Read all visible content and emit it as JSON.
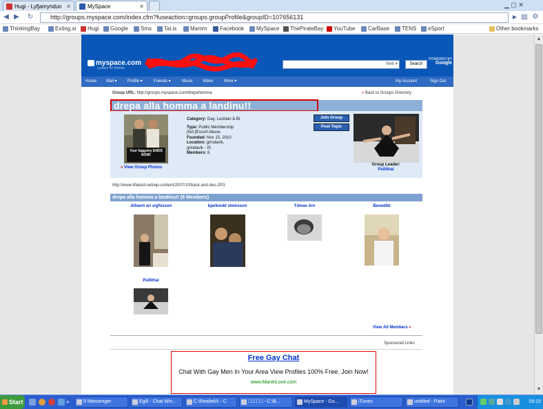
{
  "browser": {
    "tabs": [
      {
        "label": "Hugi - Lyfjamyndun",
        "active": false
      },
      {
        "label": "MySpace",
        "active": true
      }
    ],
    "url": "http://groups.myspace.com/index.cfm?fuseaction=groups.groupProfile&groupID=107656131",
    "bookmarks": [
      "ThinkingBay",
      "Exting.si",
      "Hugi",
      "Google",
      "Sms",
      "Tal.is",
      "Mamm",
      "Facebook",
      "MySpace",
      "ThePirateBay",
      "YouTube",
      "CarBase",
      "TENS",
      "eSport"
    ],
    "other_bookmarks": "Other bookmarks"
  },
  "myspace": {
    "logo": "myspace.com",
    "tagline": "a place for friends",
    "search_scope": "Web",
    "search_button": "Search",
    "powered_by": "POWERED BY",
    "google": "Google",
    "nav": [
      "Home",
      "Mail ▾",
      "Profile ▾",
      "Friends ▾",
      "Music",
      "Video",
      "More ▾"
    ],
    "nav_right": [
      "My Account",
      "Sign Out"
    ]
  },
  "group": {
    "url_label": "Group URL:",
    "url_value": "http://groups.myspace.com/drepahomma",
    "back_link": "Back to Groups Directory",
    "title": "drepa alla homma a landinu!!",
    "photo_caption": "Your faggotry ENDS NOW!",
    "view_photos": "View Group Photos",
    "details": [
      {
        "label": "Category:",
        "value": "Gay, Lesbian & Bi"
      },
      {
        "label": "Type:",
        "value": "Public Membership"
      },
      {
        "label": "",
        "value": "[hot:]Escort Abuse"
      },
      {
        "label": "Founded:",
        "value": "Nov 15, 2010"
      },
      {
        "label": "Location:",
        "value": "grindavik,"
      },
      {
        "label": "",
        "value": "grindavik - IS"
      },
      {
        "label": "Members:",
        "value": "6"
      }
    ],
    "join_button": "Join Group",
    "post_button": "Post Topic",
    "leader_label": "Group Leader:",
    "leader_name": "Pullithai",
    "image_url": "http://www.lifaetull.net/wp-content/2007/10/back-and-deo.JPG",
    "members_header": "drepa alla homma a landinu!! (6 Members)",
    "members": [
      "Jóhann ari sigfússon",
      "bjarkiodd steinsson",
      "Tómas örn",
      "Benedikt",
      "Pullithai"
    ],
    "view_all": "View All Members",
    "sponsored": "Sponsored Links"
  },
  "ad": {
    "title": "Free Gay Chat",
    "text": "Chat With Gay Men In Your Area View Profiles 100% Free. Join Now!",
    "url": "www.ManInLove.com"
  },
  "taskbar": {
    "start": "Start",
    "buttons": [
      "9 Messenger",
      "Egill - Chat Win...",
      "C:\\Realtek\\I - C",
      "□□□□□ - C:\\B...",
      "MySpace - Go...",
      "iTunes",
      "untitled - Paint"
    ],
    "tray_time": "09:15"
  },
  "colors": {
    "myspace_blue": "#0b57b8",
    "title_bar": "#8fb0d6",
    "ad_border": "#dd0000"
  }
}
